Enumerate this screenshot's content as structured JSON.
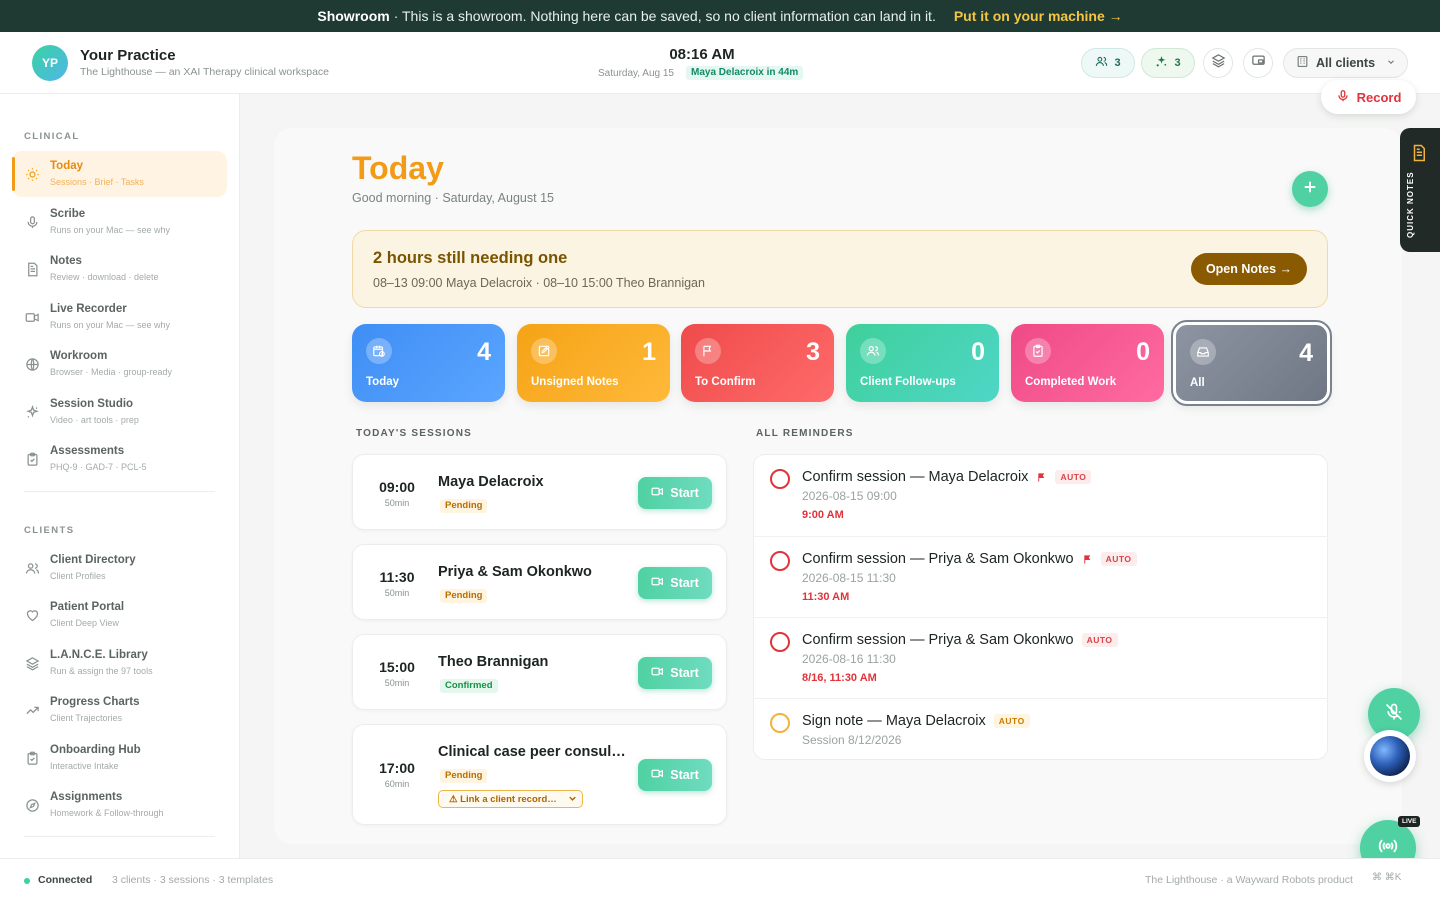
{
  "banner": {
    "strong": "Showroom",
    "text": "· This is a showroom. Nothing here can be saved, so no client information can land in it.",
    "cta": "Put it on your machine →"
  },
  "header": {
    "logo_initials": "YP",
    "title": "Your Practice",
    "subtitle": "The Lighthouse — an XAI Therapy clinical workspace",
    "time": "08:16 AM",
    "date": "Saturday, Aug 15",
    "next_session": "Maya Delacroix in 44m",
    "users_count": "3",
    "spark_count": "3",
    "clients_select": "All clients",
    "record_label": "Record"
  },
  "sidebar": {
    "clinical_label": "CLINICAL",
    "clinical_items": [
      {
        "title": "Today",
        "sub": "Sessions · Brief · Tasks",
        "icon": "sun-icon"
      },
      {
        "title": "Scribe",
        "sub": "Runs on your Mac — see why",
        "icon": "microphone-icon"
      },
      {
        "title": "Notes",
        "sub": "Review · download · delete",
        "icon": "document-icon"
      },
      {
        "title": "Live Recorder",
        "sub": "Runs on your Mac — see why",
        "icon": "video-icon"
      },
      {
        "title": "Workroom",
        "sub": "Browser · Media · group-ready",
        "icon": "globe-icon"
      },
      {
        "title": "Session Studio",
        "sub": "Video · art tools · prep",
        "icon": "sparkle-icon"
      },
      {
        "title": "Assessments",
        "sub": "PHQ-9 · GAD-7 · PCL-5",
        "icon": "clipboard-icon"
      }
    ],
    "clients_label": "CLIENTS",
    "client_items": [
      {
        "title": "Client Directory",
        "sub": "Client Profiles",
        "icon": "users-icon"
      },
      {
        "title": "Patient Portal",
        "sub": "Client Deep View",
        "icon": "heart-icon"
      },
      {
        "title": "L.A.N.C.E. Library",
        "sub": "Run & assign the 97 tools",
        "icon": "layers-icon"
      },
      {
        "title": "Progress Charts",
        "sub": "Client Trajectories",
        "icon": "trend-icon"
      },
      {
        "title": "Onboarding Hub",
        "sub": "Interactive Intake",
        "icon": "clipboard-check-icon"
      },
      {
        "title": "Assignments",
        "sub": "Homework & Follow-through",
        "icon": "compass-icon"
      }
    ]
  },
  "main": {
    "title": "Today",
    "subtitle": "Good morning · Saturday, August 15",
    "alert": {
      "title": "2 hours still needing one",
      "detail": "08–13 09:00 Maya Delacroix · 08–10 15:00 Theo Brannigan",
      "button": "Open Notes →"
    },
    "stats": [
      {
        "label": "Today",
        "value": "4",
        "icon": "calendar-clock-icon",
        "gradient": [
          "#3f8ef5",
          "#5aa5ff"
        ]
      },
      {
        "label": "Unsigned Notes",
        "value": "1",
        "icon": "edit-icon",
        "gradient": [
          "#f5a316",
          "#ffb93a"
        ]
      },
      {
        "label": "To Confirm",
        "value": "3",
        "icon": "flag-icon",
        "gradient": [
          "#ef4b4b",
          "#ff6a6a"
        ]
      },
      {
        "label": "Client Follow-ups",
        "value": "0",
        "icon": "users-icon",
        "gradient": [
          "#3fd09b",
          "#4ed6c6"
        ]
      },
      {
        "label": "Completed Work",
        "value": "0",
        "icon": "clipboard-check-icon",
        "gradient": [
          "#ef4a86",
          "#ff6ba1"
        ]
      },
      {
        "label": "All",
        "value": "4",
        "icon": "inbox-icon",
        "gradient": [
          "#8d95a3",
          "#6f7785"
        ]
      }
    ],
    "sessions_label": "TODAY'S SESSIONS",
    "sessions": [
      {
        "time": "09:00",
        "duration": "50min",
        "name": "Maya Delacroix",
        "status": "Pending",
        "status_kind": "pending",
        "button": "Start"
      },
      {
        "time": "11:30",
        "duration": "50min",
        "name": "Priya & Sam Okonkwo",
        "status": "Pending",
        "status_kind": "pending",
        "button": "Start"
      },
      {
        "time": "15:00",
        "duration": "50min",
        "name": "Theo Brannigan",
        "status": "Confirmed",
        "status_kind": "confirmed",
        "button": "Start"
      },
      {
        "time": "17:00",
        "duration": "60min",
        "name": "Clinical case peer consult…",
        "status": "Pending",
        "status_kind": "pending",
        "button": "Start",
        "link_label": "⚠ Link a client record…"
      }
    ],
    "reminders_label": "ALL REMINDERS",
    "reminders": [
      {
        "title": "Confirm session — Maya Delacroix",
        "flag": true,
        "tag": "AUTO",
        "date": "2026-08-15 09:00",
        "due": "9:00 AM",
        "kind": "urgent"
      },
      {
        "title": "Confirm session — Priya & Sam Okonkwo",
        "flag": true,
        "tag": "AUTO",
        "date": "2026-08-15 11:30",
        "due": "11:30 AM",
        "kind": "urgent"
      },
      {
        "title": "Confirm session — Priya & Sam Okonkwo",
        "flag": false,
        "tag": "AUTO",
        "date": "2026-08-16 11:30",
        "due": "8/16, 11:30 AM",
        "kind": "urgent"
      },
      {
        "title": "Sign note — Maya Delacroix",
        "flag": false,
        "tag": "AUTO",
        "date": "Session 8/12/2026",
        "due": "",
        "kind": "warn"
      }
    ]
  },
  "quick_notes_label": "QUICK NOTES",
  "live_label": "LIVE",
  "footer": {
    "connected": "Connected",
    "stats": "3 clients · 3 sessions · 3 templates",
    "product": "The Lighthouse · a Wayward Robots product",
    "shortcut": "⌘ ⌘K"
  },
  "colors": {
    "accent": "#f29b16",
    "brand_green": "#4fd1a2",
    "danger": "#e0333b",
    "banner_bg": "#1f3a33"
  }
}
